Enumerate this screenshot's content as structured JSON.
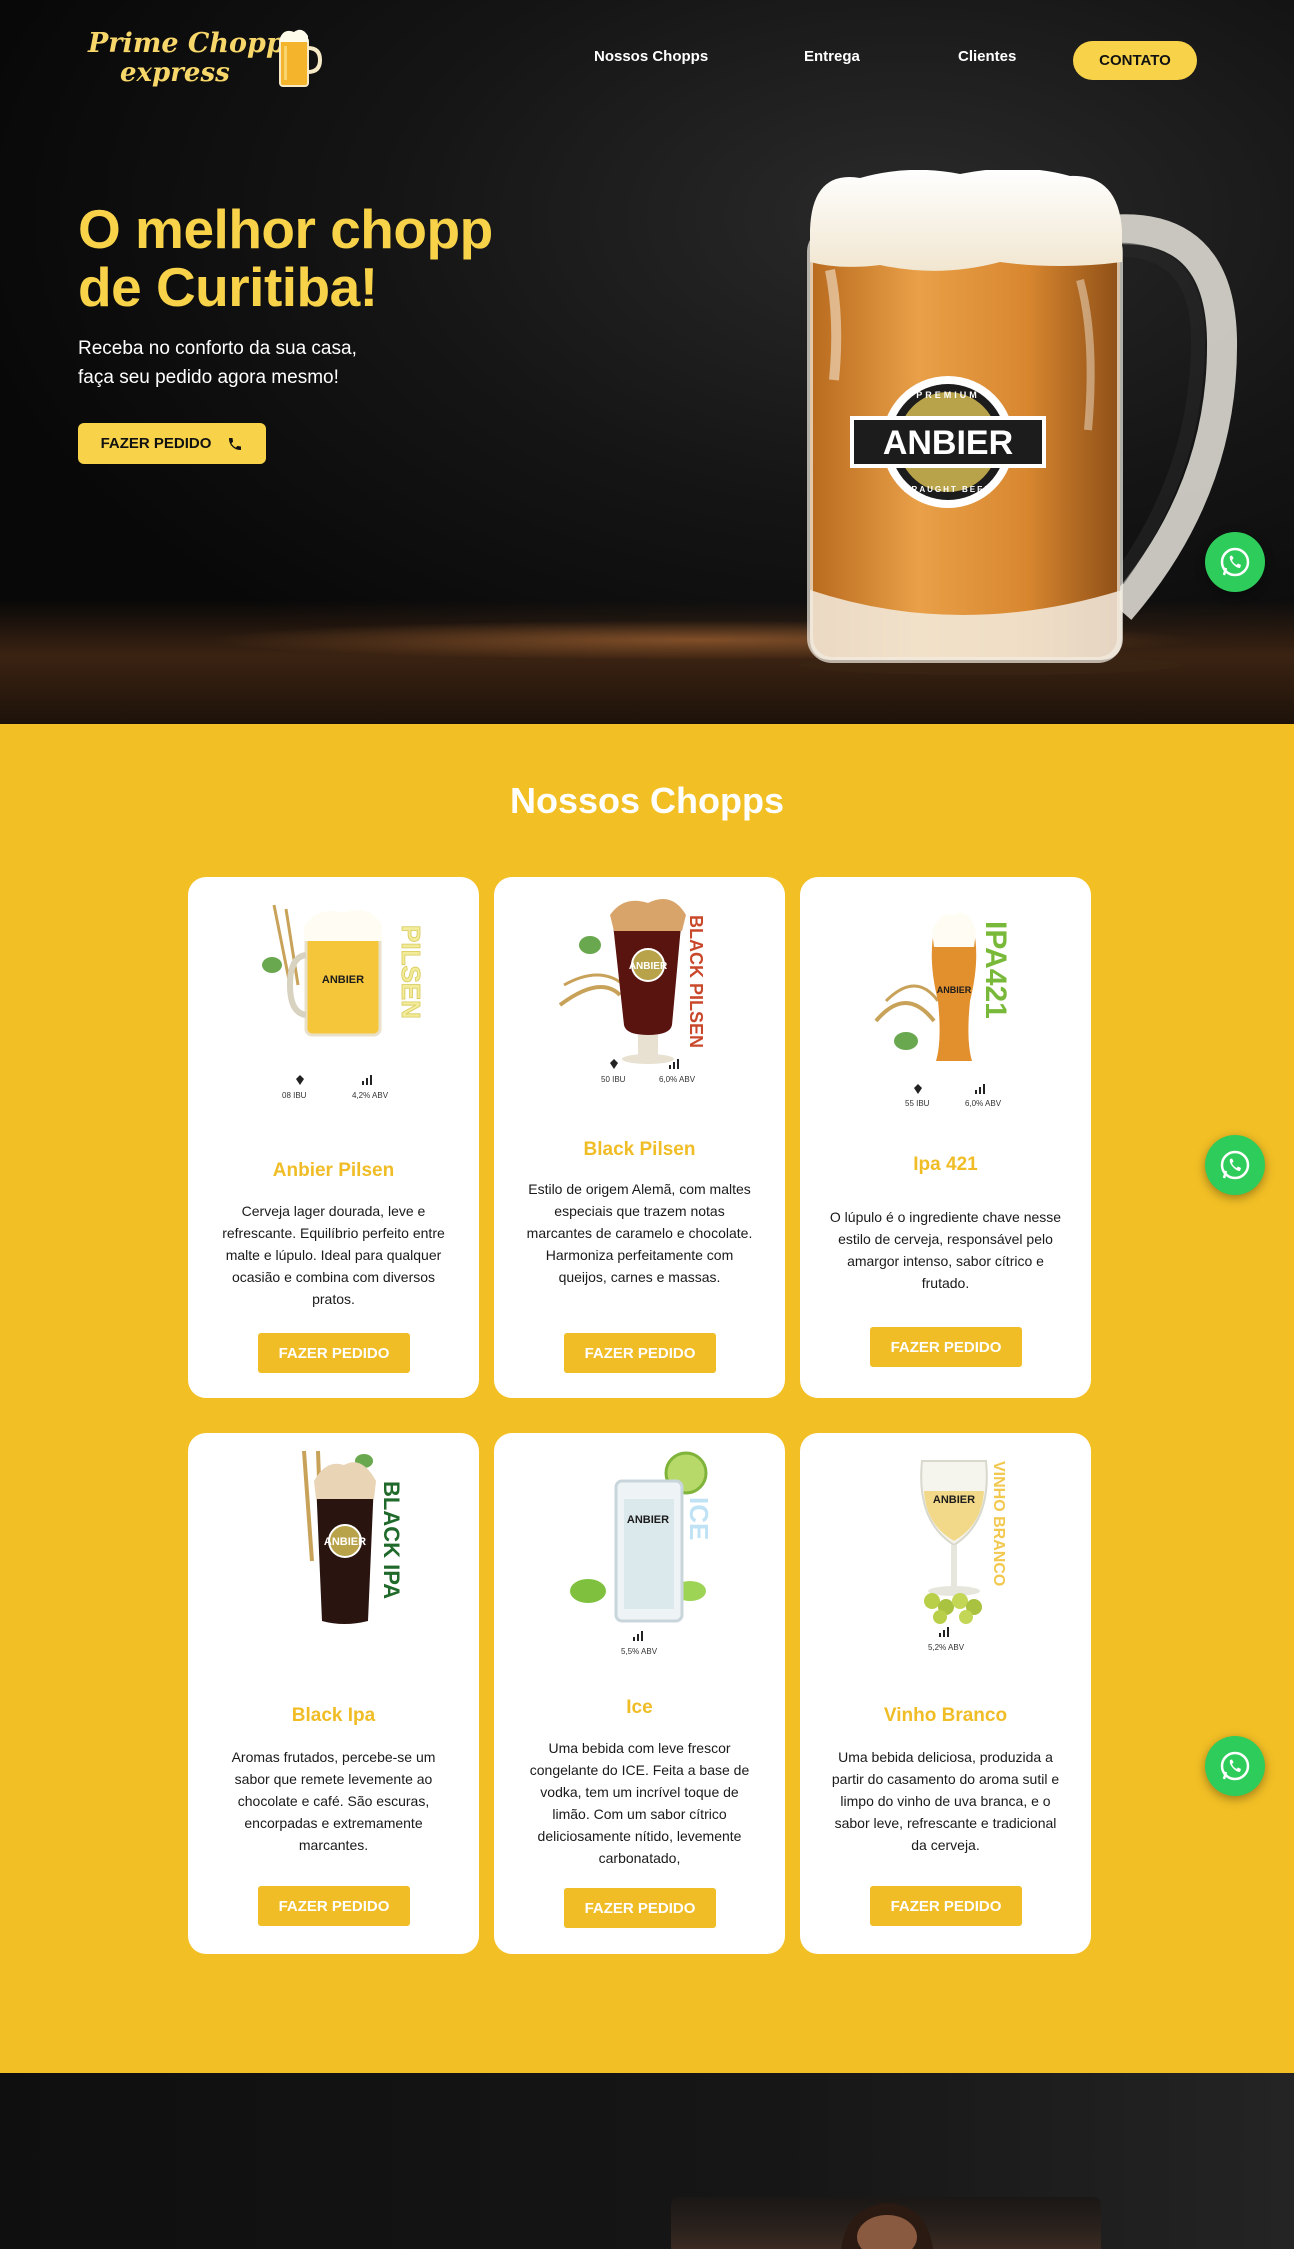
{
  "header": {
    "logo_line1": "Prime Chopp",
    "logo_line2": "express",
    "nav": [
      "Nossos Chopps",
      "Entrega",
      "Clientes"
    ],
    "contact_label": "CONTATO"
  },
  "hero": {
    "title_line1": "O melhor chopp",
    "title_line2": "de Curitiba!",
    "subtitle_line1": "Receba no conforto da sua casa,",
    "subtitle_line2": "faça seu pedido agora mesmo!",
    "cta_label": "FAZER PEDIDO",
    "mug_brand": "ANBIER",
    "mug_top_text": "PREMIUM",
    "mug_bottom_text": "DRAUGHT BEER"
  },
  "products": {
    "title": "Nossos Chopps",
    "items": [
      {
        "name": "Anbier Pilsen",
        "glass_label": "PILSEN",
        "ibu": "08 IBU",
        "abv": "4,2% ABV",
        "description": "Cerveja lager dourada, leve e refrescante. Equilíbrio perfeito entre malte e lúpulo. Ideal para qualquer ocasião e combina com diversos pratos.",
        "button": "FAZER PEDIDO"
      },
      {
        "name": "Black Pilsen",
        "glass_label": "BLACK PILSEN",
        "ibu": "50 IBU",
        "abv": "6,0% ABV",
        "description": "Estilo de origem Alemã, com maltes especiais que trazem notas marcantes de caramelo e chocolate. Harmoniza perfeitamente com queijos, carnes e massas.",
        "button": "FAZER PEDIDO"
      },
      {
        "name": "Ipa 421",
        "glass_label": "IPA421",
        "ibu": "55 IBU",
        "abv": "6,0% ABV",
        "description": "O lúpulo é o ingrediente chave nesse estilo de cerveja, responsável pelo amargor intenso, sabor cítrico e frutado.",
        "button": "FAZER PEDIDO"
      },
      {
        "name": "Black Ipa",
        "glass_label": "BLACK IPA",
        "ibu": "",
        "abv": "",
        "description": "Aromas frutados, percebe-se um sabor que remete levemente ao chocolate e café. São escuras, encorpadas e extremamente marcantes.",
        "button": "FAZER PEDIDO"
      },
      {
        "name": "Ice",
        "glass_label": "ICE",
        "ibu": "",
        "abv": "5,5% ABV",
        "description": "Uma bebida com leve frescor congelante do ICE. Feita a base de vodka, tem um incrível toque de limão. Com um sabor cítrico deliciosamente nítido, levemente carbonatado,",
        "button": "FAZER PEDIDO"
      },
      {
        "name": "Vinho Branco",
        "glass_label": "VINHO BRANCO",
        "ibu": "",
        "abv": "5,2% ABV",
        "description": "Uma bebida deliciosa, produzida a partir do casamento do aroma sutil e limpo do vinho de uva branca, e o sabor leve, refrescante e tradicional da cerveja.",
        "button": "FAZER PEDIDO"
      }
    ]
  },
  "colors": {
    "accent": "#f8d34a",
    "section_bg": "#f2bf25",
    "card_title": "#f0bd26",
    "whatsapp": "#2ecc5b"
  },
  "icons": [
    "phone-icon",
    "whatsapp-icon",
    "hop-icon",
    "bars-icon"
  ]
}
